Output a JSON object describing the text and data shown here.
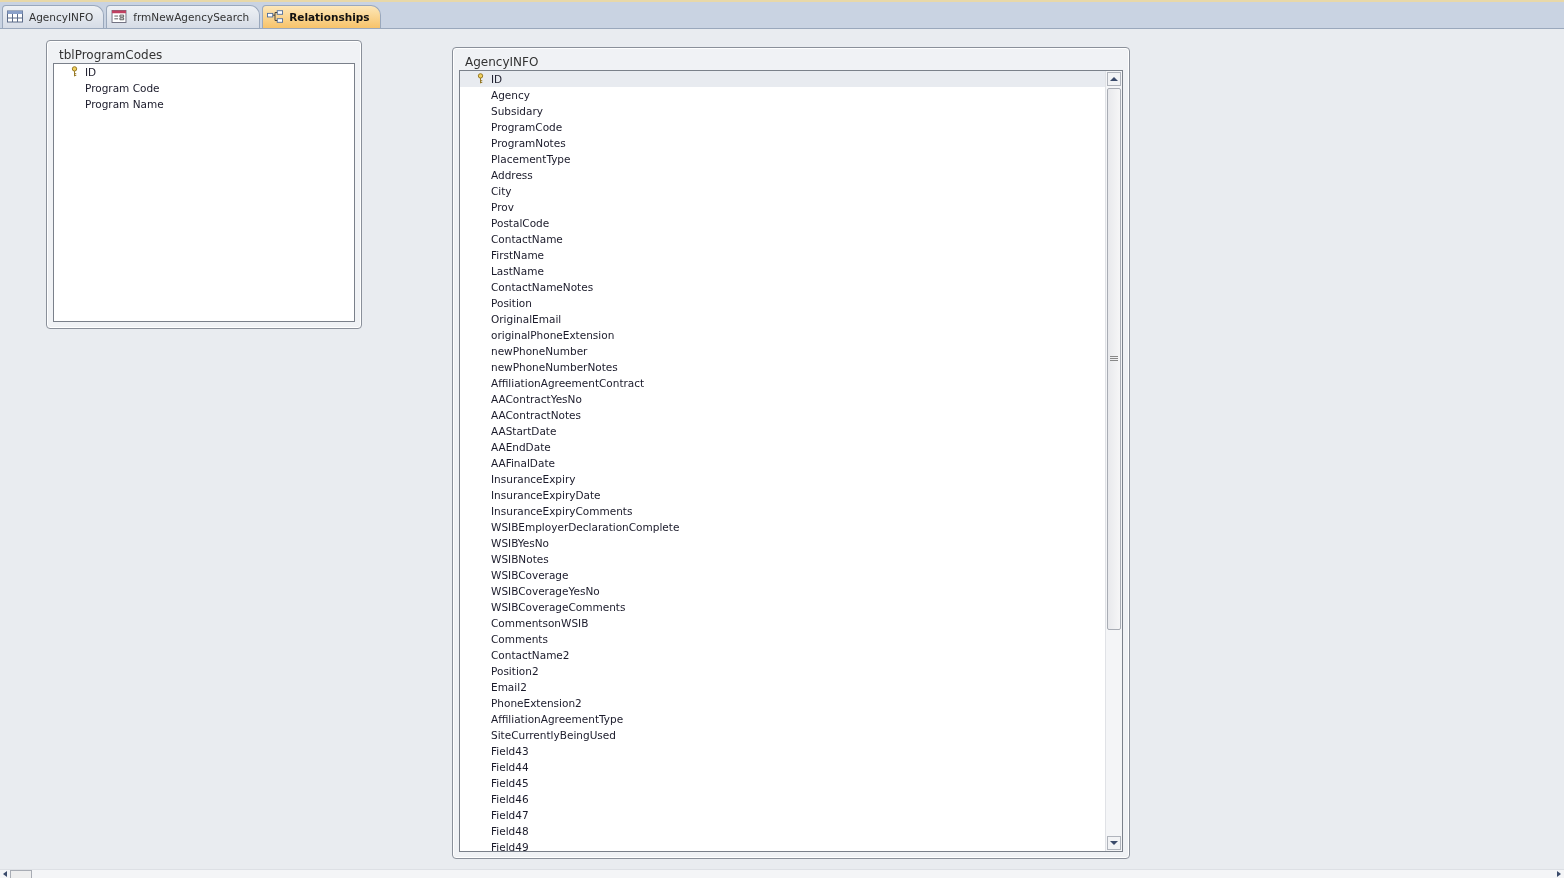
{
  "tabs": [
    {
      "label": "AgencyINFO",
      "kind": "table",
      "selected": false
    },
    {
      "label": "frmNewAgencySearch",
      "kind": "form",
      "selected": false
    },
    {
      "label": "Relationships",
      "kind": "relationships",
      "selected": true
    }
  ],
  "tables": [
    {
      "title": "tblProgramCodes",
      "scrollbar": false,
      "fields": [
        {
          "name": "ID",
          "key": true,
          "selected": false
        },
        {
          "name": "Program Code",
          "key": false,
          "selected": false
        },
        {
          "name": "Program Name",
          "key": false,
          "selected": false
        }
      ]
    },
    {
      "title": "AgencyINFO",
      "scrollbar": true,
      "fields": [
        {
          "name": "ID",
          "key": true,
          "selected": true
        },
        {
          "name": "Agency",
          "key": false,
          "selected": false
        },
        {
          "name": "Subsidary",
          "key": false,
          "selected": false
        },
        {
          "name": "ProgramCode",
          "key": false,
          "selected": false
        },
        {
          "name": "ProgramNotes",
          "key": false,
          "selected": false
        },
        {
          "name": "PlacementType",
          "key": false,
          "selected": false
        },
        {
          "name": "Address",
          "key": false,
          "selected": false
        },
        {
          "name": "City",
          "key": false,
          "selected": false
        },
        {
          "name": "Prov",
          "key": false,
          "selected": false
        },
        {
          "name": "PostalCode",
          "key": false,
          "selected": false
        },
        {
          "name": "ContactName",
          "key": false,
          "selected": false
        },
        {
          "name": "FirstName",
          "key": false,
          "selected": false
        },
        {
          "name": "LastName",
          "key": false,
          "selected": false
        },
        {
          "name": "ContactNameNotes",
          "key": false,
          "selected": false
        },
        {
          "name": "Position",
          "key": false,
          "selected": false
        },
        {
          "name": "OriginalEmail",
          "key": false,
          "selected": false
        },
        {
          "name": "originalPhoneExtension",
          "key": false,
          "selected": false
        },
        {
          "name": "newPhoneNumber",
          "key": false,
          "selected": false
        },
        {
          "name": "newPhoneNumberNotes",
          "key": false,
          "selected": false
        },
        {
          "name": "AffiliationAgreementContract",
          "key": false,
          "selected": false
        },
        {
          "name": "AAContractYesNo",
          "key": false,
          "selected": false
        },
        {
          "name": "AAContractNotes",
          "key": false,
          "selected": false
        },
        {
          "name": "AAStartDate",
          "key": false,
          "selected": false
        },
        {
          "name": "AAEndDate",
          "key": false,
          "selected": false
        },
        {
          "name": "AAFinalDate",
          "key": false,
          "selected": false
        },
        {
          "name": "InsuranceExpiry",
          "key": false,
          "selected": false
        },
        {
          "name": "InsuranceExpiryDate",
          "key": false,
          "selected": false
        },
        {
          "name": "InsuranceExpiryComments",
          "key": false,
          "selected": false
        },
        {
          "name": "WSIBEmployerDeclarationComplete",
          "key": false,
          "selected": false
        },
        {
          "name": "WSIBYesNo",
          "key": false,
          "selected": false
        },
        {
          "name": "WSIBNotes",
          "key": false,
          "selected": false
        },
        {
          "name": "WSIBCoverage",
          "key": false,
          "selected": false
        },
        {
          "name": "WSIBCoverageYesNo",
          "key": false,
          "selected": false
        },
        {
          "name": "WSIBCoverageComments",
          "key": false,
          "selected": false
        },
        {
          "name": "CommentsonWSIB",
          "key": false,
          "selected": false
        },
        {
          "name": "Comments",
          "key": false,
          "selected": false
        },
        {
          "name": "ContactName2",
          "key": false,
          "selected": false
        },
        {
          "name": "Position2",
          "key": false,
          "selected": false
        },
        {
          "name": "Email2",
          "key": false,
          "selected": false
        },
        {
          "name": "PhoneExtension2",
          "key": false,
          "selected": false
        },
        {
          "name": "AffiliationAgreementType",
          "key": false,
          "selected": false
        },
        {
          "name": "SiteCurrentlyBeingUsed",
          "key": false,
          "selected": false
        },
        {
          "name": "Field43",
          "key": false,
          "selected": false
        },
        {
          "name": "Field44",
          "key": false,
          "selected": false
        },
        {
          "name": "Field45",
          "key": false,
          "selected": false
        },
        {
          "name": "Field46",
          "key": false,
          "selected": false
        },
        {
          "name": "Field47",
          "key": false,
          "selected": false
        },
        {
          "name": "Field48",
          "key": false,
          "selected": false
        },
        {
          "name": "Field49",
          "key": false,
          "selected": false
        }
      ]
    }
  ]
}
